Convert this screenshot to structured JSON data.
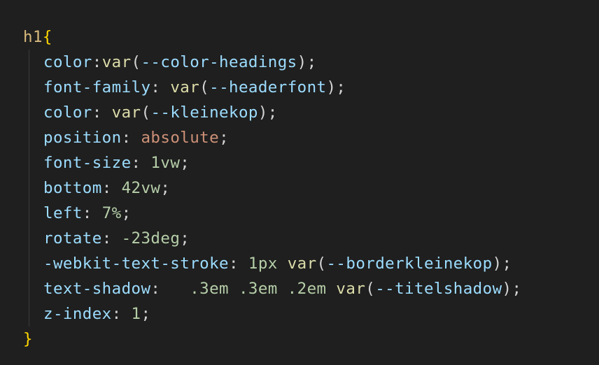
{
  "editor": {
    "language": "css",
    "colors": {
      "background": "#1f1f1f",
      "selector": "#d7ba7d",
      "brace": "#ffd700",
      "property": "#9cdcfe",
      "function": "#dcdcaa",
      "keyword_value": "#ce9178",
      "number": "#b5cea8",
      "punctuation": "#d4d4d4"
    },
    "selector": "h1",
    "open_brace": "{",
    "close_brace": "}",
    "declarations": [
      {
        "property": "color",
        "sep": ":",
        "fn": "var",
        "arg": "--color-headings",
        "end": ");"
      },
      {
        "property": "font-family",
        "sep": ": ",
        "fn": "var",
        "arg": "--headerfont",
        "end": ");"
      },
      {
        "property": "color",
        "sep": ": ",
        "fn": "var",
        "arg": "--kleinekop",
        "end": ");"
      },
      {
        "property": "position",
        "sep": ": ",
        "value": "absolute",
        "end": ";"
      },
      {
        "property": "font-size",
        "sep": ": ",
        "value": "1vw",
        "end": ";"
      },
      {
        "property": "bottom",
        "sep": ": ",
        "value": "42vw",
        "end": ";"
      },
      {
        "property": "left",
        "sep": ": ",
        "value": "7%",
        "end": ";"
      },
      {
        "property": "rotate",
        "sep": ": ",
        "value": "-23deg",
        "end": ";"
      },
      {
        "property": "-webkit-text-stroke",
        "sep": ": ",
        "value": "1px",
        "fn": "var",
        "arg": "--borderkleinekop",
        "end": ");"
      },
      {
        "property": "text-shadow",
        "sep": ":  ",
        "value": ".3em .3em .2em",
        "fn": "var",
        "arg": "--titelshadow",
        "end": ");"
      },
      {
        "property": "z-index",
        "sep": ": ",
        "value": "1",
        "end": ";"
      }
    ]
  }
}
